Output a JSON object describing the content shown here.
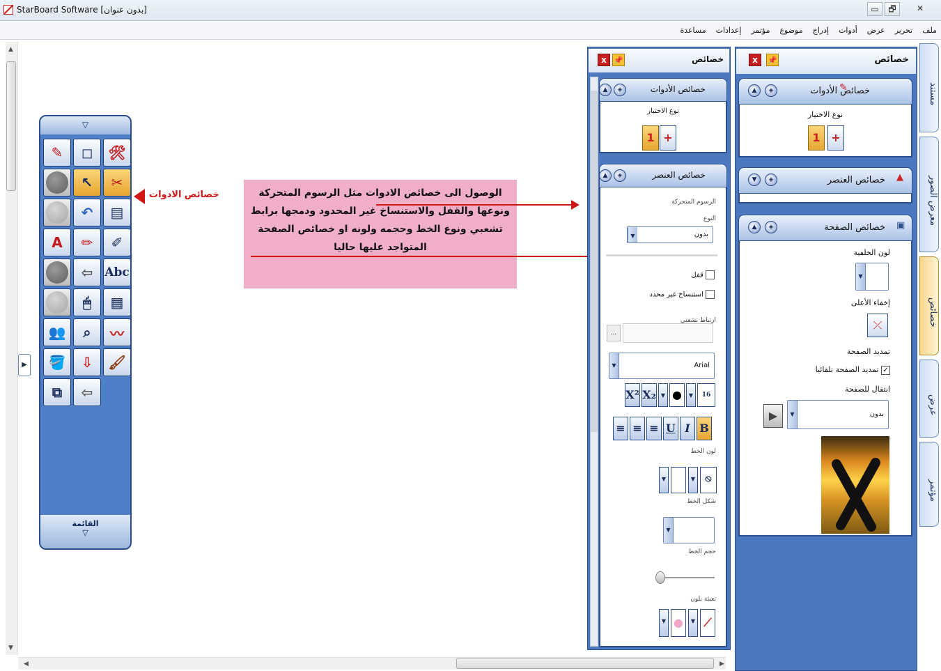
{
  "window": {
    "title": "StarBoard Software [بدون عنوان]",
    "minimize": "▭",
    "restore": "🗗",
    "close": "✕"
  },
  "menu": [
    "ملف",
    "تحرير",
    "عرض",
    "أدوات",
    "إدراج",
    "موضوع",
    "مؤتمر",
    "إعدادات",
    "مساعدة"
  ],
  "toolbox": {
    "top_arrow": "▽",
    "bottom_label": "القائمة",
    "bottom_arrow": "▽",
    "abc_label": "Abc"
  },
  "annotation": {
    "tools_label": "خصائص الادوات",
    "note": "الوصول الى خصائص الادوات مثل الرسوم المتحركة ونوعها والقفل والاستنساخ غير المحدود ودمجها برابط تشعبي ونوع الخط وحجمه ولونه او خصائص الصفحة المتواجد عليها حاليا"
  },
  "panel_middle": {
    "title": "خصائص",
    "tools_section": "خصائص الأدوات",
    "selection_type": "نوع الاختيار",
    "element_section": "خصائص العنصر",
    "animation": "الرسوم المتحركة",
    "type": "النوع",
    "type_value": "بدون",
    "lock": "قفل",
    "infinite_clone": "استنساخ غير محدد",
    "hyperlink": "ارتباط تشعبي",
    "hyperlink_btn": "...",
    "font_value": "Arial",
    "font_size": "16",
    "line_color": "لون الخط",
    "line_shape": "شكل الخط",
    "line_size": "حجم الخط",
    "fill_color": "تعبئة بلون"
  },
  "panel_right": {
    "title": "خصائص",
    "tools_section": "خصائص الأدوات",
    "selection_type": "نوع الاختيار",
    "element_section": "خصائص العنصر",
    "page_section": "خصائص الصفحة",
    "bg_color": "لون الخلفية",
    "hide_top": "إخفاء الأعلى",
    "extend_page": "تمديد الصفحة",
    "extend_auto": "تمديد الصفحة تلقائيا",
    "go_to_page": "انتقال للصفحة",
    "go_to_value": "بدون"
  },
  "side_tabs": [
    "مستند",
    "معرض الصور",
    "خصائص",
    "عرض",
    "مؤتمر"
  ],
  "colors": {
    "accent": "#4c78c0",
    "annotation_red": "#d11616",
    "note_bg": "#f0aecb"
  }
}
